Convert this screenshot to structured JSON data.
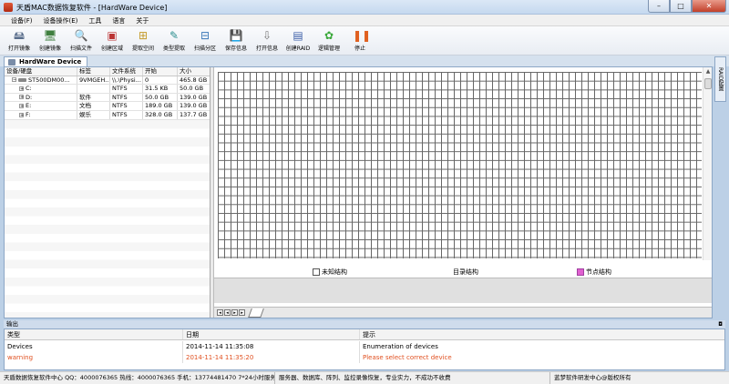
{
  "window": {
    "title": "天盾MAC数据恢复软件 - [HardWare Device]",
    "controls": {
      "minimize": "–",
      "maximize": "□",
      "close": "✕"
    }
  },
  "menu": [
    "设备(F)",
    "设备操作(E)",
    "工具",
    "语言",
    "关于"
  ],
  "toolbar": [
    {
      "label": "打开镜像",
      "icon": "open-image-icon",
      "glyph": "🖴",
      "color": "#5a6e8c"
    },
    {
      "label": "创建镜像",
      "icon": "create-image-icon",
      "glyph": "🖥",
      "color": "#3f7f3f"
    },
    {
      "label": "扫描文件",
      "icon": "scan-file-icon",
      "glyph": "🔍",
      "color": "#2c6fb5"
    },
    {
      "label": "创建区域",
      "icon": "create-region-icon",
      "glyph": "▣",
      "color": "#b33"
    },
    {
      "label": "提取空间",
      "icon": "extract-space-icon",
      "glyph": "⊞",
      "color": "#c59a2a"
    },
    {
      "label": "类型提取",
      "icon": "type-extract-icon",
      "glyph": "✎",
      "color": "#2a8d8d"
    },
    {
      "label": "扫描分区",
      "icon": "scan-partition-icon",
      "glyph": "⊟",
      "color": "#3a78b8"
    },
    {
      "label": "保存信息",
      "icon": "save-info-icon",
      "glyph": "💾",
      "color": "#333"
    },
    {
      "label": "打开信息",
      "icon": "open-info-icon",
      "glyph": "⇩",
      "color": "#777"
    },
    {
      "label": "创建RAID",
      "icon": "create-raid-icon",
      "glyph": "▤",
      "color": "#3b5ea8"
    },
    {
      "label": "逻辑管理",
      "icon": "logic-manage-icon",
      "glyph": "✿",
      "color": "#3aa83a"
    },
    {
      "label": "停止",
      "icon": "stop-icon",
      "glyph": "❚❚",
      "color": "#e06020"
    }
  ],
  "doc_tab": "HardWare Device",
  "side_tab": "RAID配置",
  "table": {
    "columns": [
      "设备/硬盘",
      "标签",
      "文件系统",
      "开始",
      "大小"
    ],
    "rows": [
      {
        "name": "ST500DM00...",
        "label": "9VMGEH...",
        "fs": "\\\\.\\Physi...",
        "start": "0",
        "size": "465.8 GB",
        "level": 0
      },
      {
        "name": "C:",
        "label": "",
        "fs": "NTFS",
        "start": "31.5 KB",
        "size": "50.0 GB",
        "level": 1
      },
      {
        "name": "D:",
        "label": "软件",
        "fs": "NTFS",
        "start": "50.0 GB",
        "size": "139.0 GB",
        "level": 1
      },
      {
        "name": "E:",
        "label": "文档",
        "fs": "NTFS",
        "start": "189.0 GB",
        "size": "139.0 GB",
        "level": 1
      },
      {
        "name": "F:",
        "label": "娱乐",
        "fs": "NTFS",
        "start": "328.0 GB",
        "size": "137.7 GB",
        "level": 1
      }
    ]
  },
  "legend": {
    "unknown": "未知结构",
    "directory": "目录结构",
    "node": "节点结构",
    "node_color": "#e060d0"
  },
  "output": {
    "title": "输出",
    "columns": [
      "类型",
      "日期",
      "提示"
    ],
    "rows": [
      {
        "type": "Devices",
        "date": "2014-11-14 11:35:08",
        "msg": "Enumeration of devices",
        "level": "info"
      },
      {
        "type": "warning",
        "date": "2014-11-14 11:35:20",
        "msg": "Please select correct device",
        "level": "warn"
      }
    ]
  },
  "status": [
    "天盾数据恢复软件中心 QQ：4000076365 热线：4000076365 手机：13774481470   7*24小时服务",
    "服务器、数据库、阵列、监控录像恢复，专业实力，不成功不收费",
    "蓝梦软件研发中心@版权所有"
  ]
}
